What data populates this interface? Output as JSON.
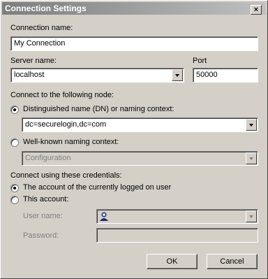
{
  "window": {
    "title": "Connection Settings",
    "close_glyph": "×"
  },
  "connection_name": {
    "label": "Connection name:",
    "value": "My Connection"
  },
  "server": {
    "label": "Server name:",
    "value": "localhost"
  },
  "port": {
    "label": "Port",
    "value": "50000"
  },
  "node": {
    "label": "Connect to the following node:",
    "dn_option": "Distinguished name (DN) or naming context:",
    "dn_value": "dc=securelogin,dc=com",
    "wellknown_option": "Well-known naming context:",
    "wellknown_value": "Configuration"
  },
  "credentials": {
    "label": "Connect using these credentials:",
    "current_user_option": "The account of the currently logged on user",
    "this_account_option": "This account:",
    "username_label": "User name:",
    "password_label": "Password:"
  },
  "buttons": {
    "ok": "OK",
    "cancel": "Cancel"
  }
}
